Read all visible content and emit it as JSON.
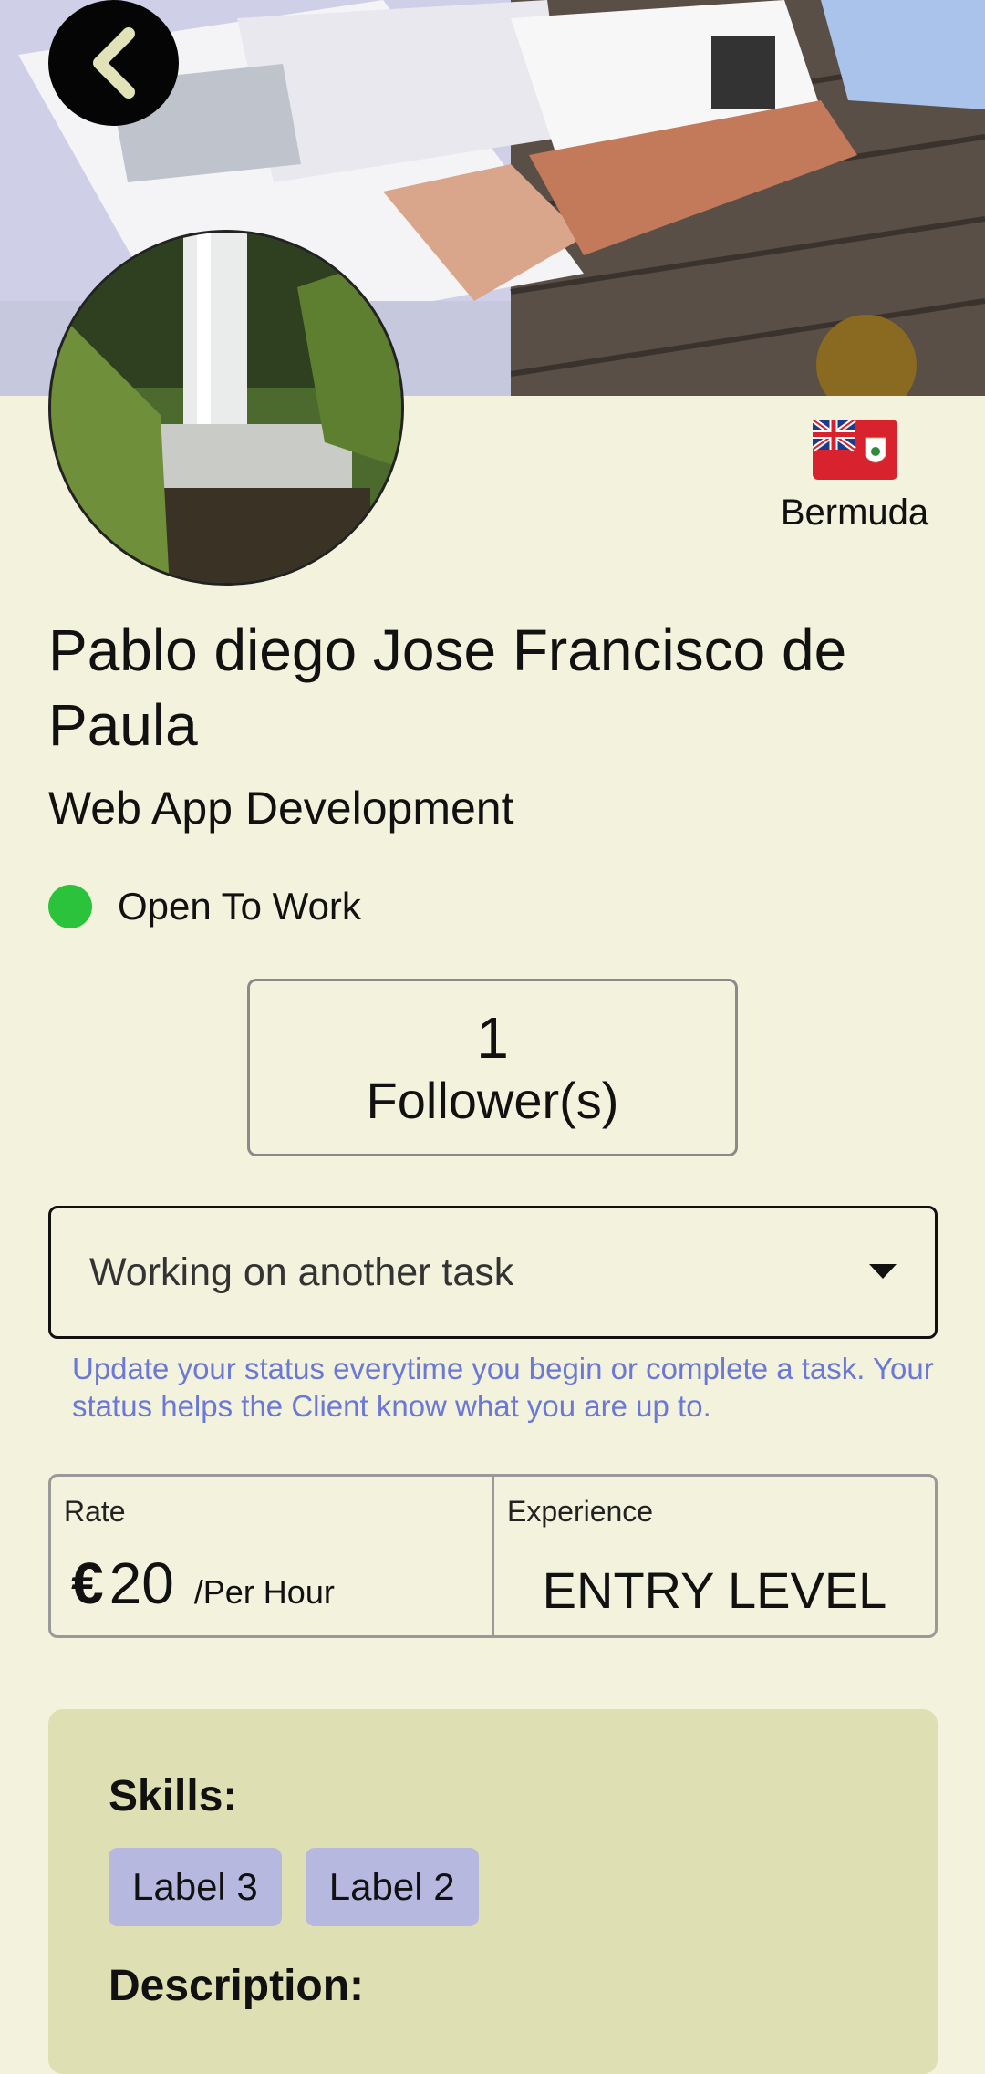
{
  "header": {
    "back_icon": "chevron-left-icon"
  },
  "profile": {
    "country": "Bermuda",
    "name": "Pablo diego Jose  Francisco de Paula",
    "role": "Web App Development",
    "availability": "Open To Work",
    "availability_color": "#2bc33b"
  },
  "followers": {
    "count": "1",
    "label": "Follower(s)"
  },
  "status_select": {
    "value": "Working on another task",
    "helper": "Update your status everytime you begin or complete a task. Your status helps the Client know what you are up to."
  },
  "rate": {
    "label": "Rate",
    "currency": "€",
    "amount": "20",
    "unit": "/Per Hour"
  },
  "experience": {
    "label": "Experience",
    "value": "ENTRY LEVEL"
  },
  "skills": {
    "heading": "Skills:",
    "items": [
      "Label 3",
      "Label 2"
    ]
  },
  "description": {
    "heading": "Description:"
  }
}
